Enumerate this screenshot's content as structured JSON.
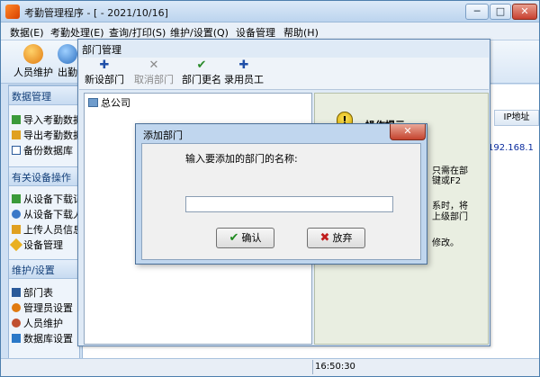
{
  "app": {
    "title": "考勤管理程序 - [ - 2021/10/16]",
    "window_buttons": {
      "minimize": "─",
      "maximize": "□",
      "close": "✕"
    }
  },
  "menu": [
    "数据(E)",
    "考勤处理(E)",
    "查询/打印(S)",
    "维护/设置(Q)",
    "设备管理",
    "帮助(H)"
  ],
  "toolbar": [
    {
      "label": "人员维护",
      "icon": "people-icon"
    },
    {
      "label": "出勤",
      "icon": "attendance-icon"
    }
  ],
  "left_panel": {
    "groups": [
      {
        "title": "数据管理",
        "items": [
          {
            "label": "导入考勤数据",
            "icon": "import-arrow-icon"
          },
          {
            "label": "导出考勤数据",
            "icon": "export-arrow-icon"
          },
          {
            "label": "备份数据库",
            "icon": "backup-icon"
          }
        ]
      },
      {
        "title": "有关设备操作",
        "items": [
          {
            "label": "从设备下载记录",
            "icon": "download-icon"
          },
          {
            "label": "从设备下载人员",
            "icon": "download-user-icon"
          },
          {
            "label": "上传人员信息",
            "icon": "upload-icon"
          },
          {
            "label": "设备管理",
            "icon": "device-icon"
          }
        ]
      },
      {
        "title": "维护/设置",
        "items": [
          {
            "label": "部门表",
            "icon": "department-icon"
          },
          {
            "label": "管理员设置",
            "icon": "admin-icon"
          },
          {
            "label": "人员维护",
            "icon": "people-icon"
          },
          {
            "label": "数据库设置",
            "icon": "database-icon"
          }
        ]
      }
    ]
  },
  "right_area": {
    "ip_header": "IP地址",
    "ip_value": "192.168.1"
  },
  "status": {
    "time": "16:50:30"
  },
  "dept_window": {
    "title": "部门管理",
    "toolbar": [
      {
        "label": "新设部门",
        "glyph": "✚",
        "icon": "new-department-icon",
        "enabled": true,
        "color": "#1f4fa8"
      },
      {
        "label": "取消部门",
        "glyph": "✕",
        "icon": "cancel-department-icon",
        "enabled": false,
        "color": "#8a8a8a"
      },
      {
        "label": "部门更名",
        "glyph": "✔",
        "icon": "rename-department-icon",
        "enabled": true,
        "color": "#2a8a2a"
      },
      {
        "label": "录用员工",
        "glyph": "✚",
        "icon": "hire-employee-icon",
        "enabled": true,
        "color": "#1f4fa8"
      }
    ],
    "tree_root": "总公司",
    "hint": {
      "icon": "!",
      "title": "操作提示",
      "lines": [
        "只需在部",
        "键或F2",
        "",
        "系时，将",
        "上级部门",
        "",
        "",
        "修改。"
      ]
    }
  },
  "add_dialog": {
    "title": "添加部门",
    "prompt": "输入要添加的部门的名称:",
    "input_value": "",
    "ok_label": "确认",
    "ok_glyph": "✔",
    "cancel_label": "放弃",
    "cancel_glyph": "✖",
    "close_glyph": "✕"
  },
  "colors": {
    "group_title": "#14407a",
    "ip_text": "#0b2c9e",
    "ok_green": "#1f8a1f",
    "cancel_red": "#c01d1d"
  }
}
